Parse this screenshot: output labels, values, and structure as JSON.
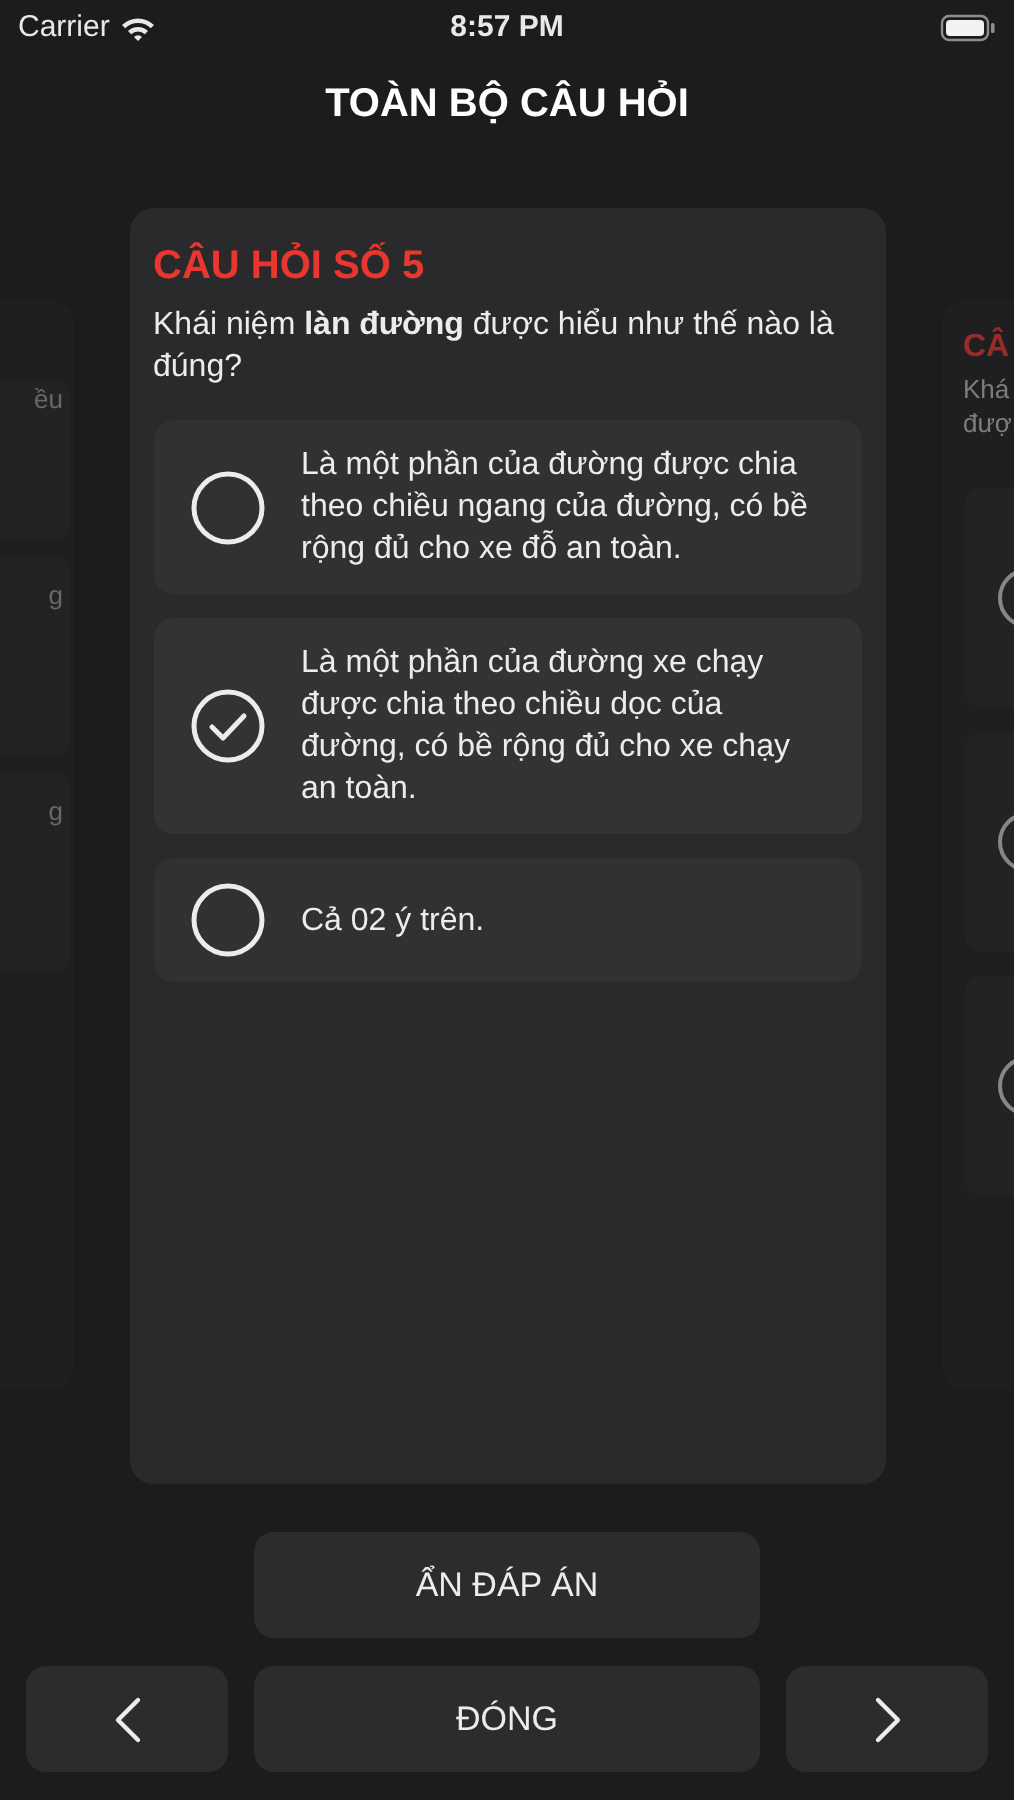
{
  "status_bar": {
    "carrier": "Carrier",
    "time": "8:57 PM"
  },
  "title": "TOÀN BỘ CÂU HỎI",
  "prev_card": {
    "fragments": [
      "ều",
      "g",
      "g"
    ]
  },
  "card": {
    "heading": "CÂU HỎI SỐ 5",
    "question": "Khái niệm **làn đường** được hiểu như thế nào là đúng?",
    "options": [
      {
        "text": "Là một phần của đường được chia theo chiều ngang của đường, có bề rộng đủ cho xe đỗ an toàn.",
        "selected": false
      },
      {
        "text": "Là một phần của đường xe chạy được chia theo chiều dọc của đường, có bề rộng đủ cho xe chạy an toàn.",
        "selected": true
      },
      {
        "text": "Cả 02 ý trên.",
        "selected": false
      }
    ]
  },
  "next_card": {
    "heading": "CÂ",
    "question_lines": [
      "Khá",
      "đượ"
    ]
  },
  "hide_answer_button": "ẨN ĐÁP ÁN",
  "close_button": "ĐÓNG"
}
